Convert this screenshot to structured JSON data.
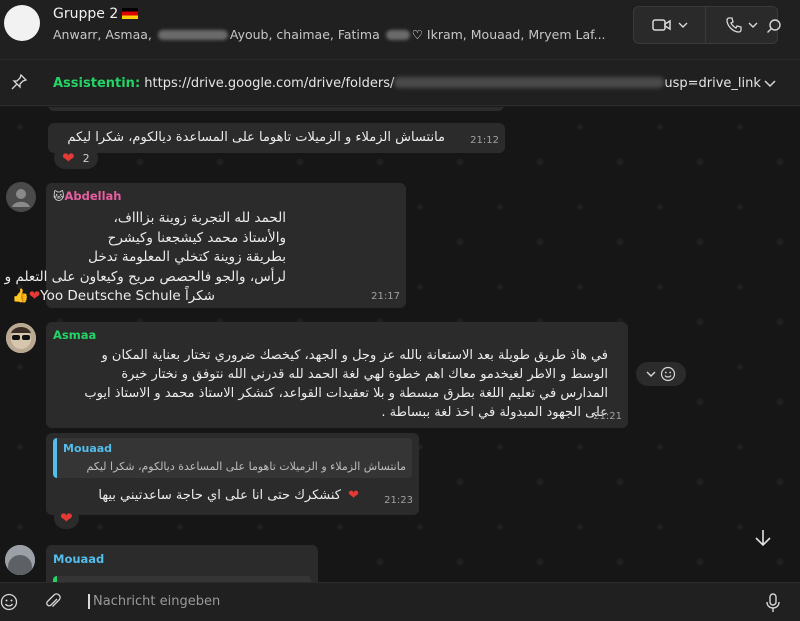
{
  "header": {
    "title": "Gruppe 2",
    "members": [
      "Anwarr, Asmaa, ",
      "Ayoub, chaimae, Fatima ",
      " Ikram, Mouaad, Mryem Laf..."
    ]
  },
  "pinned": {
    "author": "Assistentin:",
    "text": " https://drive.google.com/drive/folders/",
    "tail": "usp=drive_link"
  },
  "messages": {
    "m1": {
      "text": "مانتساش الزملاء و الزميلات تاهوما على المساعدة ديالكوم، شكرا ليكم",
      "time": "21:12",
      "reaction_count": "2"
    },
    "m2": {
      "sender": "Abdellah",
      "sender_color": "#e85fa0",
      "lines": [
        "الحمد لله التجربة زوينة بزاااف،",
        "والأستاذ محمد كيشجعنا وكيشرح",
        "بطريقة زوينة كتخلي المعلومة تدخل",
        "لرأس، والجو فالحصص مريح وكيعاون على التعلم و التطور.",
        "شكراً Yoo Deutsche Schule"
      ],
      "time": "21:17"
    },
    "m3": {
      "sender": "Asmaa",
      "sender_color": "#25d366",
      "lines": [
        "في هاذ طريق طويلة بعد الاستعانة بالله عز وجل و الجهد، كيخصك ضروري تختار بعناية المكان و",
        "الوسط و الاطر لغيخدمو معاك اهم خطوة لهي لغة الحمد لله قدرني الله نتوفق و نختار خيرة",
        "المدارس في تعليم اللغة بطرق مبسطة و بلا تعقيدات القواعد، كنشكر الاستاذ محمد و الاستاذ ايوب",
        "على الجهود المبدولة في اخذ لغة ببساطة ."
      ],
      "time": "21:21"
    },
    "m4": {
      "quote_author": "Mouaad",
      "quote_text": "مانتساش الزملاء و الزميلات تاهوما على المساعدة ديالكوم، شكرا ليكم",
      "text": "كنشكرك حتى انا على اي حاجة ساعدتيني بيها",
      "time": "21:23"
    },
    "m5": {
      "sender": "Mouaad",
      "sender_color": "#53bdeb"
    }
  },
  "composer": {
    "placeholder": "Nachricht eingeben"
  },
  "colors": {
    "accent_green": "#25d366",
    "bubble": "#2b2b2b",
    "background": "#161616"
  },
  "icons": [
    "video-icon",
    "phone-icon",
    "search-icon",
    "pin-icon",
    "chevron-down-icon",
    "emoji-icon",
    "attach-icon",
    "mic-icon",
    "arrow-down-icon"
  ]
}
